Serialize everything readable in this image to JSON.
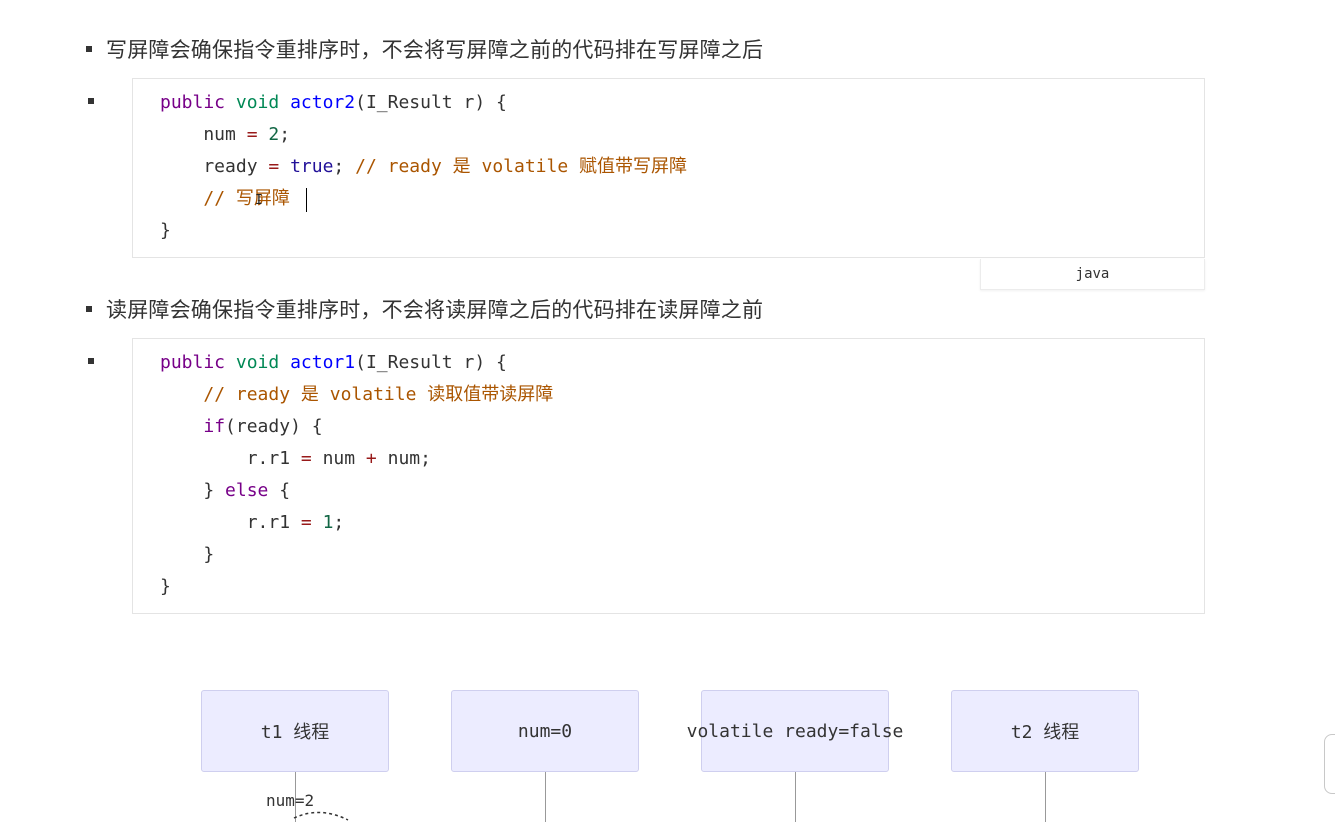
{
  "bullets": {
    "write_barrier_text": "写屏障会确保指令重排序时，不会将写屏障之前的代码排在写屏障之后",
    "read_barrier_text": "读屏障会确保指令重排序时，不会将读屏障之后的代码排在读屏障之前"
  },
  "code_block_1": {
    "language": "java",
    "lines": [
      "public void actor2(I_Result r) {",
      "    num = 2;",
      "    ready = true; // ready 是 volatile 赋值带写屏障",
      "    // 写屏障",
      "}"
    ]
  },
  "code_block_2": {
    "lines": [
      "public void actor1(I_Result r) {",
      "    // ready 是 volatile 读取值带读屏障",
      "    if(ready) {",
      "        r.r1 = num + num;",
      "    } else {",
      "        r.r1 = 1;",
      "    }",
      "}"
    ]
  },
  "diagram": {
    "actors": [
      "t1 线程",
      "num=0",
      "volatile ready=false",
      "t2 线程"
    ],
    "message_label": "num=2"
  },
  "colors": {
    "keyword": "#770088",
    "type": "#008855",
    "function": "#0000ff",
    "operator": "#981a1a",
    "number": "#116644",
    "atom": "#221199",
    "comment": "#aa5500",
    "actor_fill": "#ececff",
    "actor_border": "#cfcfef"
  }
}
